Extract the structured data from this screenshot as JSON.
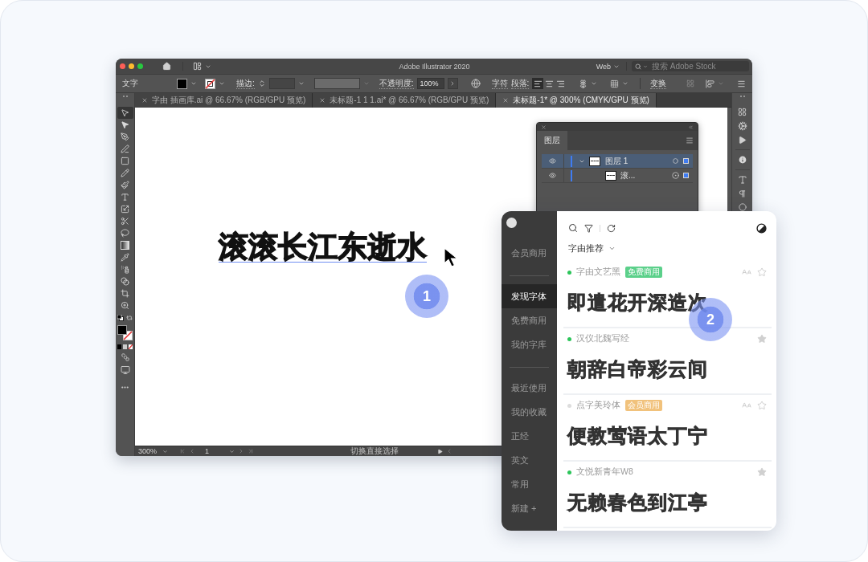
{
  "illustrator": {
    "title": "Adobe Illustrator 2020",
    "workspace": "Web",
    "stock_search": {
      "placeholder": "搜索 Adobe Stock"
    },
    "control_bar": {
      "mode": "文字",
      "stroke_label": "描边:",
      "opacity_label": "不透明度:",
      "opacity_value": "100%",
      "character_link": "字符",
      "paragraph_link": "段落:",
      "alignment": [
        {
          "kind": "left",
          "selected": true
        },
        {
          "kind": "center",
          "selected": false
        },
        {
          "kind": "right",
          "selected": false
        }
      ],
      "transform_link": "变换"
    },
    "document_tabs": [
      {
        "label": "字由 插画库.ai @ 66.67% (RGB/GPU 预览)",
        "selected": false
      },
      {
        "label": "未标题-1 1 1.ai* @ 66.67% (RGB/GPU 预览)",
        "selected": false
      },
      {
        "label": "未标题-1* @ 300% (CMYK/GPU 预览)",
        "selected": true
      }
    ],
    "tools": [
      {
        "kind": "selection",
        "selected": true
      },
      {
        "kind": "direct-selection",
        "selected": false
      },
      {
        "kind": "pen",
        "selected": false
      },
      {
        "kind": "curvature",
        "selected": false
      },
      {
        "kind": "rectangle",
        "selected": false
      },
      {
        "kind": "pencil",
        "selected": false
      },
      {
        "kind": "paintbrush",
        "selected": false
      },
      {
        "kind": "type",
        "selected": false
      },
      {
        "kind": "scale",
        "selected": false
      },
      {
        "kind": "scissors",
        "selected": false
      },
      {
        "kind": "lasso",
        "selected": false
      },
      {
        "kind": "gradient",
        "selected": false
      },
      {
        "kind": "eyedropper",
        "selected": false
      },
      {
        "kind": "symbol-sprayer",
        "selected": false
      },
      {
        "kind": "blend",
        "selected": false
      },
      {
        "kind": "artboard",
        "selected": false
      },
      {
        "kind": "zoom",
        "selected": false
      }
    ],
    "artboard_text": {
      "text": "滚滚长江东逝水",
      "selected": true
    },
    "status_bar": {
      "zoom": "300%",
      "artboard": "1",
      "hint": "切换直接选择"
    },
    "layers_panel": {
      "tab": "图层",
      "layers": [
        {
          "name": "图层 1",
          "selected": true,
          "expanded": true,
          "children": [
            {
              "name": "滚...",
              "selected": false
            }
          ]
        }
      ]
    }
  },
  "font_panel": {
    "sidebar": [
      {
        "items": [
          {
            "label": "会员商用",
            "selected": false
          }
        ]
      },
      {
        "items": [
          {
            "label": "发现字体",
            "selected": true
          },
          {
            "label": "免费商用",
            "selected": false
          },
          {
            "label": "我的字库",
            "selected": false
          }
        ]
      },
      {
        "items": [
          {
            "label": "最近使用",
            "selected": false
          },
          {
            "label": "我的收藏",
            "selected": false
          },
          {
            "label": "正经",
            "selected": false
          },
          {
            "label": "英文",
            "selected": false
          },
          {
            "label": "常用",
            "selected": false
          },
          {
            "label": "新建 +",
            "selected": false
          }
        ]
      }
    ],
    "source": "字由推荐",
    "fonts": [
      {
        "name": "字由文艺黑",
        "color": "#2cc55a",
        "badge": {
          "label": "免费商用",
          "kind": "free"
        },
        "addable": true,
        "favorited": false,
        "sample": "即遣花开深造次"
      },
      {
        "name": "汉仪北魏写经",
        "color": "#2cc55a",
        "addable": false,
        "favorited": true,
        "sample": "朝辞白帝彩云间"
      },
      {
        "name": "点字美玲体",
        "color": "#dddddd",
        "badge": {
          "label": "会员商用",
          "kind": "member"
        },
        "addable": true,
        "favorited": false,
        "sample": "便教莺语太丁宁"
      },
      {
        "name": "文悦新青年W8",
        "color": "#2cc55a",
        "addable": false,
        "favorited": true,
        "sample": "无赖春色到江亭"
      }
    ]
  },
  "callouts": [
    {
      "label": "1"
    },
    {
      "label": "2"
    }
  ]
}
